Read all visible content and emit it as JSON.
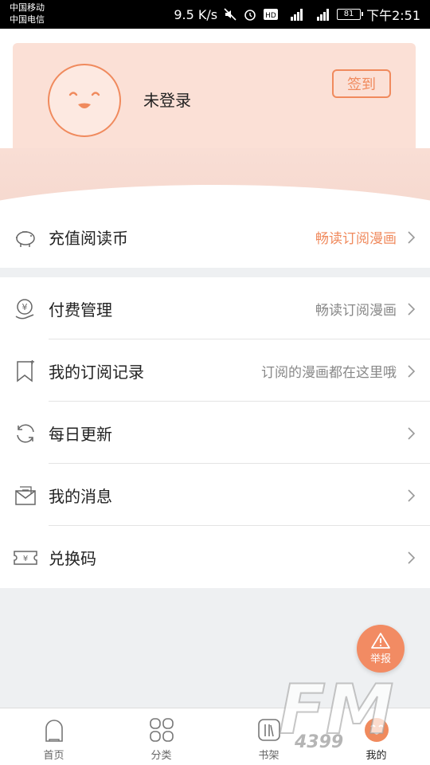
{
  "status_bar": {
    "carrier_1": "中国移动",
    "carrier_2": "中国电信",
    "net_speed": "9.5 K/s",
    "battery": "81",
    "time": "下午2:51"
  },
  "header": {
    "login_text": "未登录",
    "signin_label": "签到"
  },
  "menu_top": [
    {
      "label": "充值阅读币",
      "hint": "畅读订阅漫画",
      "icon": "piggy-bank-icon"
    }
  ],
  "menu_main": [
    {
      "label": "付费管理",
      "hint": "畅读订阅漫画",
      "icon": "yen-hand-icon"
    },
    {
      "label": "我的订阅记录",
      "hint": "订阅的漫画都在这里哦",
      "icon": "bookmark-icon"
    },
    {
      "label": "每日更新",
      "hint": "",
      "icon": "refresh-icon"
    },
    {
      "label": "我的消息",
      "hint": "",
      "icon": "mail-icon"
    },
    {
      "label": "兑换码",
      "hint": "",
      "icon": "ticket-icon"
    }
  ],
  "fab": {
    "label": "举报"
  },
  "bottom_nav": [
    {
      "label": "首页",
      "icon": "home-icon"
    },
    {
      "label": "分类",
      "icon": "category-icon"
    },
    {
      "label": "书架",
      "icon": "bookshelf-icon"
    },
    {
      "label": "我的",
      "icon": "profile-icon"
    }
  ],
  "colors": {
    "accent": "#f08a5d",
    "header_bg": "#fbe0d6"
  }
}
